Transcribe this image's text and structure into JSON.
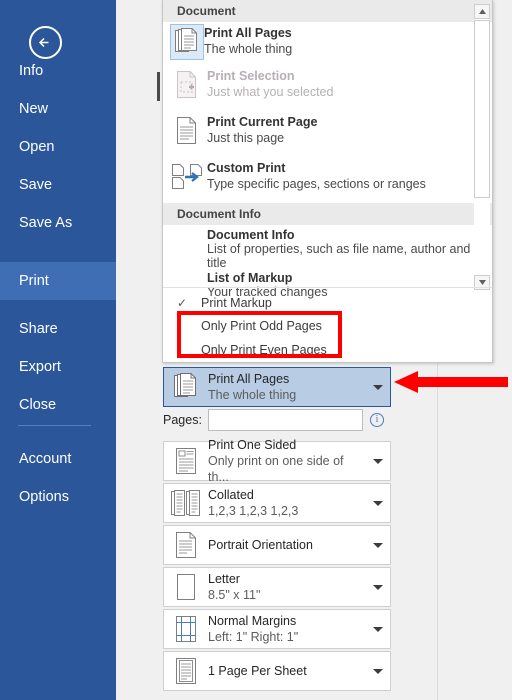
{
  "sidebar": {
    "back_label": "Back",
    "items": [
      {
        "label": "Info",
        "active": false
      },
      {
        "label": "New",
        "active": false
      },
      {
        "label": "Open",
        "active": false
      },
      {
        "label": "Save",
        "active": false
      },
      {
        "label": "Save As",
        "active": false
      },
      {
        "label": "Print",
        "active": true
      },
      {
        "label": "Share",
        "active": false
      },
      {
        "label": "Export",
        "active": false
      },
      {
        "label": "Close",
        "active": false
      },
      {
        "label": "Account",
        "active": false
      },
      {
        "label": "Options",
        "active": false
      }
    ],
    "accent": "#2b579a",
    "active_color": "#3f6eb5"
  },
  "dropdown": {
    "groups": [
      {
        "header": "Document",
        "items": [
          {
            "title": "Print All Pages",
            "subtitle": "The whole thing",
            "icon": "stacked-pages-icon",
            "selected": true,
            "disabled": false
          },
          {
            "title": "Print Selection",
            "subtitle": "Just what you selected",
            "icon": "page-selection-icon",
            "selected": false,
            "disabled": true
          },
          {
            "title": "Print Current Page",
            "subtitle": "Just this page",
            "icon": "single-page-icon",
            "selected": false,
            "disabled": false
          },
          {
            "title": "Custom Print",
            "subtitle": "Type specific pages, sections or ranges",
            "icon": "custom-print-icon",
            "selected": false,
            "disabled": false
          }
        ]
      },
      {
        "header": "Document Info",
        "items": [
          {
            "title": "Document Info",
            "subtitle": "List of properties, such as file name, author and title"
          },
          {
            "title": "List of Markup",
            "subtitle": "Your tracked changes"
          }
        ]
      }
    ],
    "bottom_options": [
      {
        "label": "Print Markup",
        "checked": true
      },
      {
        "label": "Only Print Odd Pages",
        "checked": false
      },
      {
        "label": "Only Print Even Pages",
        "checked": false
      }
    ],
    "checkmark": "✓",
    "scroll_up": "▲",
    "scroll_down": "▼"
  },
  "highlight": {
    "color": "#ff0000",
    "box_target": "odd-even-pages-options",
    "arrow_target": "print-all-pages-combo"
  },
  "settings": {
    "pages_label": "Pages:",
    "pages_value": "",
    "pages_placeholder": "",
    "info_glyph": "i",
    "combos": [
      {
        "title": "Print All Pages",
        "subtitle": "The whole thing",
        "icon": "stacked-pages-icon",
        "highlighted": true
      },
      {
        "title": "Print One Sided",
        "subtitle": "Only print on one side of th...",
        "icon": "one-sided-icon",
        "highlighted": false
      },
      {
        "title": "Collated",
        "subtitle": "1,2,3   1,2,3   1,2,3",
        "icon": "collated-icon",
        "highlighted": false
      },
      {
        "title": "Portrait Orientation",
        "subtitle": "",
        "icon": "portrait-icon",
        "highlighted": false
      },
      {
        "title": "Letter",
        "subtitle": "8.5\" x 11\"",
        "icon": "paper-size-icon",
        "highlighted": false
      },
      {
        "title": "Normal Margins",
        "subtitle": "Left:  1\"   Right:  1\"",
        "icon": "margins-icon",
        "highlighted": false
      },
      {
        "title": "1 Page Per Sheet",
        "subtitle": "",
        "icon": "pages-per-sheet-icon",
        "highlighted": false
      }
    ]
  }
}
